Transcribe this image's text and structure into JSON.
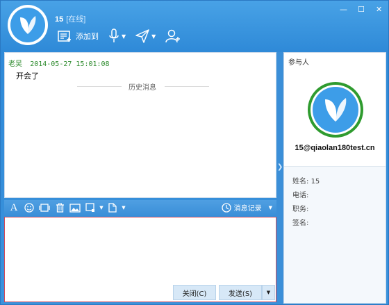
{
  "header": {
    "title": "15",
    "status": "[在线]",
    "window_controls": [
      "—",
      "☐",
      "✕"
    ],
    "add_to_label": "添加到"
  },
  "chat": {
    "messages": [
      {
        "sender": "老吴",
        "time": "2014-05-27 15:01:08",
        "text": "开会了"
      }
    ],
    "history_label": "历史消息"
  },
  "format_bar": {
    "font_icon_text": "A",
    "history_button": "消息记录"
  },
  "input": {
    "close_button": "关闭(C)",
    "send_button": "发送(S)"
  },
  "participants": {
    "title": "参与人",
    "email": "15@qiaolan180test.cn",
    "fields": [
      {
        "label": "姓名:",
        "value": "15"
      },
      {
        "label": "电话:",
        "value": ""
      },
      {
        "label": "职务:",
        "value": ""
      },
      {
        "label": "签名:",
        "value": ""
      }
    ]
  },
  "colors": {
    "titlebar": "#2f8ad8",
    "accent": "#3d9de8",
    "sender": "#2e8b2e",
    "input_border": "#d04a5a"
  }
}
